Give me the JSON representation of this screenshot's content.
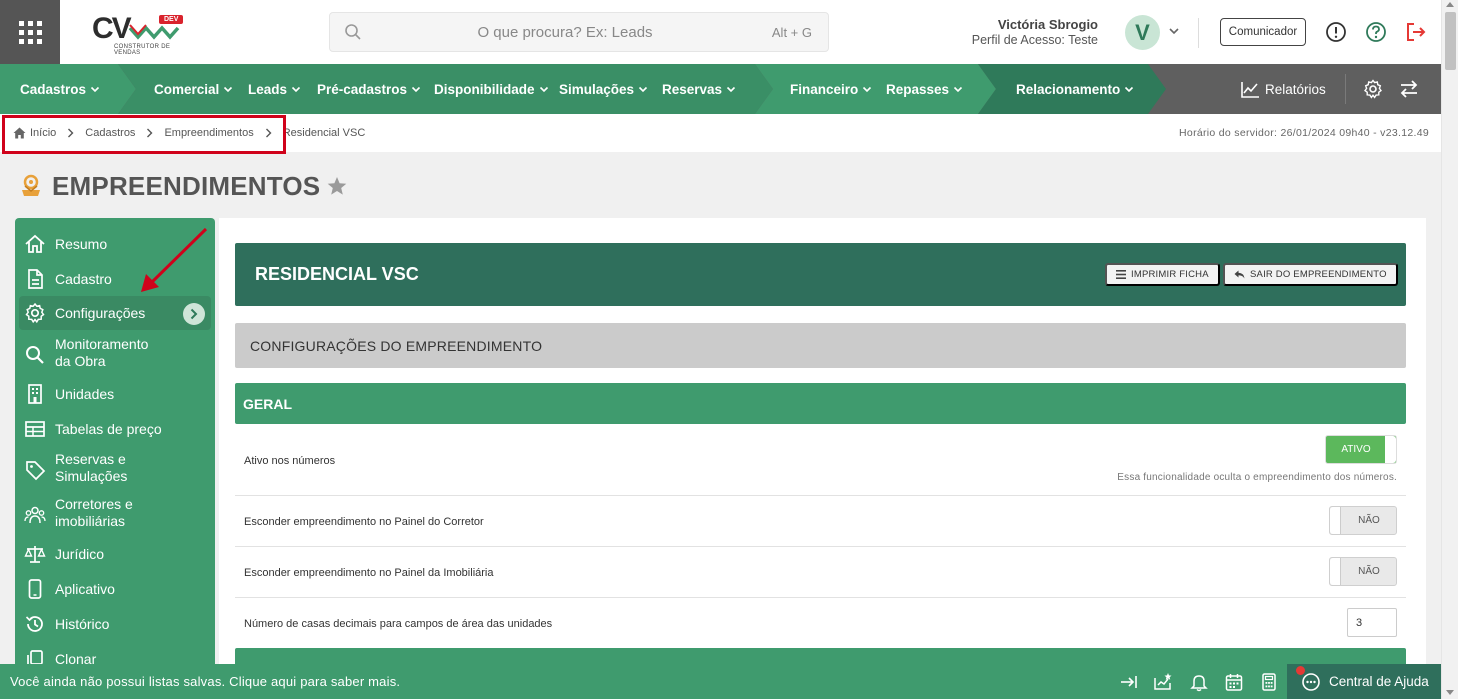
{
  "header": {
    "search_placeholder": "O que procura? Ex: Leads",
    "search_shortcut": "Alt + G",
    "logo_text": "CV",
    "logo_badge": "DEV",
    "logo_subtitle": "CONSTRUTOR DE VENDAS",
    "user_name": "Victória Sbrogio",
    "user_profile": "Perfil de Acesso: Teste",
    "avatar_initial": "V",
    "communicator_label": "Comunicador"
  },
  "nav": {
    "items": [
      {
        "label": "Cadastros"
      },
      {
        "label": "Comercial"
      },
      {
        "label": "Leads"
      },
      {
        "label": "Pré-cadastros"
      },
      {
        "label": "Disponibilidade"
      },
      {
        "label": "Simulações"
      },
      {
        "label": "Reservas"
      },
      {
        "label": "Financeiro"
      },
      {
        "label": "Repasses"
      },
      {
        "label": "Relacionamento"
      }
    ],
    "reports_label": "Relatórios",
    "colors": {
      "seg1": "#3f9b6e",
      "seg2": "#3a8f66",
      "seg3": "#2f7a5a",
      "rest": "#5f5f5f"
    }
  },
  "breadcrumb": {
    "items": [
      "Início",
      "Cadastros",
      "Empreendimentos",
      "Residencial VSC"
    ],
    "server_time": "Horário do servidor: 26/01/2024 09h40 - v23.12.49"
  },
  "page": {
    "title": "EMPREENDIMENTOS"
  },
  "sidebar": {
    "items": [
      {
        "label": "Resumo",
        "icon": "home-icon"
      },
      {
        "label": "Cadastro",
        "icon": "document-icon"
      },
      {
        "label": "Configurações",
        "icon": "gear-icon"
      },
      {
        "label": "Monitoramento da Obra",
        "icon": "search-icon"
      },
      {
        "label": "Unidades",
        "icon": "building-icon"
      },
      {
        "label": "Tabelas de preço",
        "icon": "table-icon"
      },
      {
        "label": "Reservas e Simulações",
        "icon": "tag-icon"
      },
      {
        "label": "Corretores e imobiliárias",
        "icon": "users-icon"
      },
      {
        "label": "Jurídico",
        "icon": "scale-icon"
      },
      {
        "label": "Aplicativo",
        "icon": "phone-icon"
      },
      {
        "label": "Histórico",
        "icon": "history-icon"
      },
      {
        "label": "Clonar",
        "icon": "clone-icon"
      }
    ],
    "active": "Configurações"
  },
  "main": {
    "enterprise_name": "RESIDENCIAL VSC",
    "print_label": "IMPRIMIR FICHA",
    "exit_label": "SAIR DO EMPREENDIMENTO",
    "section_title": "CONFIGURAÇÕES DO EMPREENDIMENTO",
    "group_title": "GERAL",
    "rows": [
      {
        "label": "Ativo nos números",
        "toggle": "ATIVO",
        "state": "on",
        "description": "Essa funcionalidade oculta o empreendimento dos números."
      },
      {
        "label": "Esconder empreendimento no Painel do Corretor",
        "toggle": "NÃO",
        "state": "off"
      },
      {
        "label": "Esconder empreendimento no Painel da Imobiliária",
        "toggle": "NÃO",
        "state": "off"
      },
      {
        "label": "Número de casas decimais para campos de área das unidades",
        "value": "3"
      }
    ]
  },
  "footer": {
    "message": "Você ainda não possui listas salvas. Clique aqui para saber mais.",
    "help_label": "Central de Ajuda"
  }
}
